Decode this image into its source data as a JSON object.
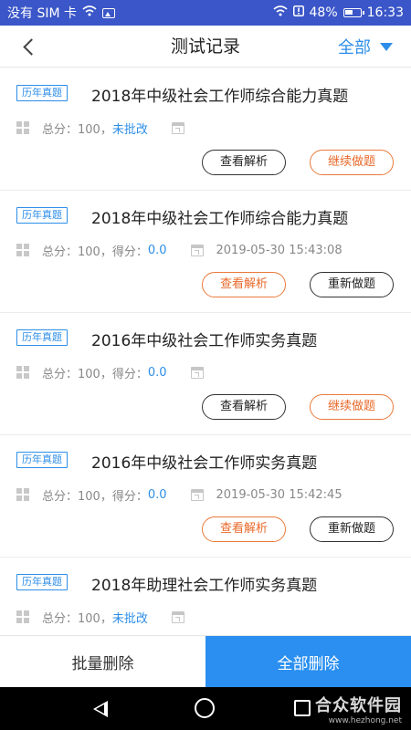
{
  "status_bar": {
    "carrier": "没有 SIM 卡",
    "battery": "48%",
    "time": "16:33"
  },
  "header": {
    "title": "测试记录",
    "filter_label": "全部"
  },
  "records": [
    {
      "tag": "历年真题",
      "title": "2018年中级社会工作师综合能力真题",
      "score_text": "总分：100，",
      "status": "未批改",
      "date": "",
      "left_button": "查看解析",
      "right_button": "继续做题"
    },
    {
      "tag": "历年真题",
      "title": "2018年中级社会工作师综合能力真题",
      "score_text": "总分：100，得分：",
      "status": "0.0",
      "date": "2019-05-30 15:43:08",
      "left_button": "查看解析",
      "right_button": "重新做题"
    },
    {
      "tag": "历年真题",
      "title": "2016年中级社会工作师实务真题",
      "score_text": "总分：100，得分：",
      "status": "0.0",
      "date": "",
      "left_button": "查看解析",
      "right_button": "继续做题"
    },
    {
      "tag": "历年真题",
      "title": "2016年中级社会工作师实务真题",
      "score_text": "总分：100，得分：",
      "status": "0.0",
      "date": "2019-05-30 15:42:45",
      "left_button": "查看解析",
      "right_button": "重新做题"
    },
    {
      "tag": "历年真题",
      "title": "2018年助理社会工作师实务真题",
      "score_text": "总分：100，",
      "status": "未批改",
      "date": ""
    }
  ],
  "actions": {
    "batch_delete": "批量删除",
    "delete_all": "全部删除"
  },
  "watermark": {
    "name": "合众软件园",
    "url": "www.hezhong.net"
  },
  "colors": {
    "status_bar": "#3a56c8",
    "accent_blue": "#2d8ee8",
    "accent_orange": "#e8692a",
    "primary_button": "#2a8ff0"
  }
}
